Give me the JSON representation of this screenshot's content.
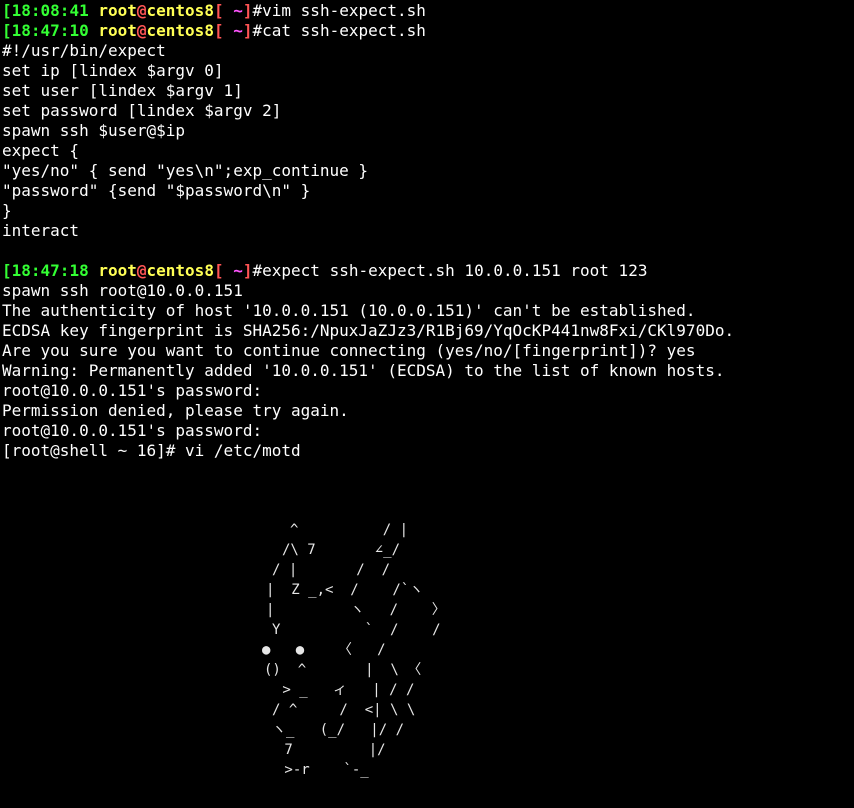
{
  "colors": {
    "background": "#000000",
    "text": "#ffffff",
    "time": "#33ff33",
    "user_host": "#ffff55",
    "at_sign": "#ff5555",
    "directory": "#ff55ff"
  },
  "prompts": [
    {
      "time": "18:08:41",
      "user": "root",
      "at": "@",
      "host": "centos8",
      "dir": " ~",
      "command": "vim ssh-expect.sh"
    },
    {
      "time": "18:47:10",
      "user": "root",
      "at": "@",
      "host": "centos8",
      "dir": " ~",
      "command": "cat ssh-expect.sh"
    },
    {
      "time": "18:47:18",
      "user": "root",
      "at": "@",
      "host": "centos8",
      "dir": " ~",
      "command": "expect ssh-expect.sh 10.0.0.151 root 123"
    }
  ],
  "script_lines": [
    "#!/usr/bin/expect",
    "set ip [lindex $argv 0]",
    "set user [lindex $argv 1]",
    "set password [lindex $argv 2]",
    "spawn ssh $user@$ip",
    "expect {",
    "\"yes/no\" { send \"yes\\n\";exp_continue }",
    "\"password\" {send \"$password\\n\" }",
    "}",
    "interact"
  ],
  "output_lines": [
    "spawn ssh root@10.0.0.151",
    "The authenticity of host '10.0.0.151 (10.0.0.151)' can't be established.",
    "ECDSA key fingerprint is SHA256:/NpuxJaZJz3/R1Bj69/YqOcKP441nw8Fxi/CKl970Do.",
    "Are you sure you want to continue connecting (yes/no/[fingerprint])? yes",
    "Warning: Permanently added '10.0.0.151' (ECDSA) to the list of known hosts.",
    "root@10.0.0.151's password:",
    "Permission denied, please try again.",
    "root@10.0.0.151's password:",
    "[root@shell ~ 16]# vi /etc/motd"
  ],
  "motd_art": [
    "^          / |",
    "/\\ 7       ∠_/",
    "/ |       /  /",
    "|  Z _,<  /    /`ヽ",
    "|         ヽ   /    〉",
    "Y          `  /    /",
    "●   ●    〈   /",
    "()  ^       |  \\ 〈",
    " > _   ィ   | / /",
    "/ ^     /  <| \\ \\",
    "ヽ_   (_/   |/ /",
    " 7         |/",
    " >-r    `-_"
  ]
}
